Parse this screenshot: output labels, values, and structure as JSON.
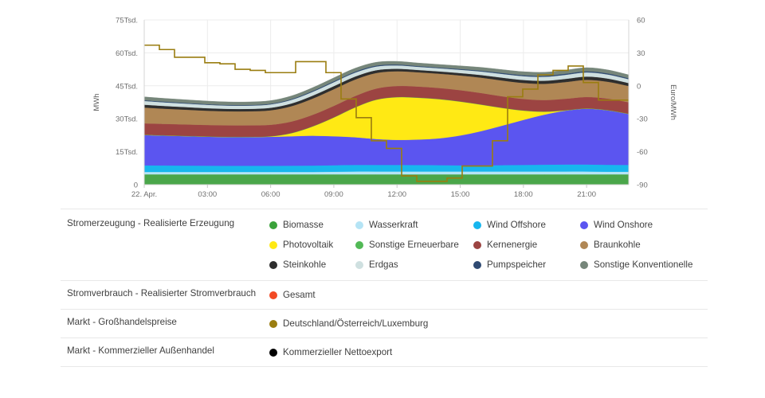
{
  "chart_data": {
    "type": "area",
    "title": "",
    "subtitle": "",
    "stacking": "normal",
    "grid": true,
    "legend_position": "bottom-table",
    "xlabel": "",
    "ylabel": "MWh",
    "y2label": "Euro/MWh",
    "x_tick_labels": [
      "22. Apr.",
      "03:00",
      "06:00",
      "09:00",
      "12:00",
      "15:00",
      "18:00",
      "21:00"
    ],
    "y_tick_labels": [
      "0",
      "15Tsd.",
      "30Tsd.",
      "45Tsd.",
      "60Tsd.",
      "75Tsd."
    ],
    "y_tick_values": [
      0,
      15000,
      30000,
      45000,
      60000,
      75000
    ],
    "ylim": [
      0,
      75000
    ],
    "y2_tick_labels": [
      "-90",
      "-60",
      "-30",
      "0",
      "30",
      "60"
    ],
    "y2_tick_values": [
      -90,
      -60,
      -30,
      0,
      30,
      60
    ],
    "y2lim": [
      -90,
      60
    ],
    "x": [
      "00:00",
      "01:00",
      "02:00",
      "03:00",
      "04:00",
      "05:00",
      "06:00",
      "07:00",
      "08:00",
      "09:00",
      "10:00",
      "11:00",
      "12:00",
      "13:00",
      "14:00",
      "15:00",
      "16:00",
      "17:00",
      "18:00",
      "19:00",
      "20:00",
      "21:00",
      "22:00",
      "23:00"
    ],
    "series": [
      {
        "name": "Biomasse",
        "color": "#4aa64a",
        "values": [
          4700,
          4700,
          4700,
          4700,
          4700,
          4700,
          4700,
          4700,
          4700,
          4700,
          4700,
          4700,
          4700,
          4700,
          4700,
          4700,
          4700,
          4700,
          4700,
          4700,
          4700,
          4700,
          4700,
          4700
        ]
      },
      {
        "name": "Wasserkraft",
        "color": "#b5e4f5",
        "values": [
          1100,
          1100,
          1100,
          1100,
          1100,
          1100,
          1100,
          1100,
          1100,
          1200,
          1300,
          1300,
          1300,
          1300,
          1300,
          1300,
          1300,
          1300,
          1300,
          1300,
          1300,
          1300,
          1200,
          1200
        ]
      },
      {
        "name": "Wind Offshore",
        "color": "#17b6ee",
        "values": [
          3000,
          2950,
          2900,
          2850,
          2800,
          2800,
          2800,
          2850,
          2900,
          2950,
          3000,
          3000,
          3000,
          2950,
          2900,
          2800,
          2800,
          2900,
          3000,
          3100,
          3200,
          3200,
          3150,
          3100
        ]
      },
      {
        "name": "Wind Onshore",
        "color": "#5b55f0",
        "values": [
          13800,
          13600,
          13400,
          13200,
          13100,
          13100,
          13200,
          13400,
          13600,
          13200,
          12600,
          11800,
          11400,
          11600,
          12200,
          13600,
          15600,
          18000,
          20500,
          22800,
          24500,
          25400,
          24800,
          23200
        ]
      },
      {
        "name": "Photovoltaik",
        "color": "#ffe914",
        "values": [
          0,
          0,
          0,
          0,
          0,
          0,
          150,
          1400,
          4200,
          8500,
          13500,
          17800,
          19400,
          19000,
          17800,
          15400,
          12000,
          8000,
          4200,
          1300,
          100,
          0,
          0,
          0
        ]
      },
      {
        "name": "Sonstige Erneuerbare",
        "color": "#52b956",
        "values": [
          120,
          120,
          120,
          120,
          120,
          120,
          120,
          120,
          120,
          120,
          120,
          120,
          120,
          120,
          120,
          120,
          120,
          120,
          120,
          120,
          120,
          120,
          120,
          120
        ]
      },
      {
        "name": "Kernenergie",
        "color": "#9c4442",
        "values": [
          5200,
          5200,
          5200,
          5200,
          5200,
          5200,
          5200,
          5200,
          5200,
          5200,
          5100,
          5000,
          5000,
          5000,
          5000,
          5100,
          5200,
          5200,
          5200,
          5200,
          5200,
          5200,
          5200,
          5200
        ]
      },
      {
        "name": "Braunkohle",
        "color": "#b08755",
        "values": [
          7200,
          6900,
          6700,
          6500,
          6400,
          6400,
          6600,
          7000,
          7400,
          7600,
          7500,
          7100,
          6700,
          6500,
          6500,
          6700,
          7000,
          7200,
          7300,
          7400,
          7600,
          7800,
          7700,
          7400
        ]
      },
      {
        "name": "Steinkohle",
        "color": "#2e2e2e",
        "values": [
          1300,
          1250,
          1200,
          1150,
          1100,
          1100,
          1150,
          1250,
          1350,
          1400,
          1380,
          1280,
          1150,
          1050,
          1050,
          1100,
          1200,
          1300,
          1350,
          1400,
          1450,
          1500,
          1450,
          1350
        ]
      },
      {
        "name": "Erdgas",
        "color": "#cfe0e0",
        "values": [
          1700,
          1650,
          1600,
          1550,
          1500,
          1500,
          1550,
          1650,
          1750,
          1800,
          1780,
          1680,
          1550,
          1450,
          1450,
          1500,
          1600,
          1700,
          1750,
          1800,
          1850,
          1900,
          1850,
          1750
        ]
      },
      {
        "name": "Pumpspeicher",
        "color": "#2f4a72",
        "values": [
          350,
          330,
          310,
          290,
          280,
          280,
          300,
          340,
          380,
          420,
          440,
          420,
          380,
          340,
          330,
          350,
          390,
          430,
          460,
          480,
          500,
          520,
          500,
          450
        ]
      },
      {
        "name": "Sonstige Konventionelle",
        "color": "#76867a",
        "values": [
          1500,
          1450,
          1420,
          1400,
          1380,
          1380,
          1400,
          1450,
          1500,
          1550,
          1550,
          1500,
          1430,
          1380,
          1380,
          1420,
          1480,
          1520,
          1550,
          1580,
          1600,
          1620,
          1580,
          1520
        ]
      }
    ],
    "lines": [
      {
        "name": "Deutschland/Österreich/Luxemburg",
        "color": "#9a7d10",
        "axis": "y2",
        "step": true,
        "values": [
          37,
          33,
          26,
          26,
          21,
          20,
          15,
          14,
          12,
          12,
          22,
          22,
          12,
          -12,
          -29,
          -50,
          -57,
          -82,
          -87,
          -87,
          -84,
          -73,
          -73,
          -50,
          -10,
          -3,
          10,
          14,
          18,
          3,
          -13,
          -13
        ]
      },
      {
        "name": "Gesamt",
        "color": "#f24a25",
        "axis": "y",
        "visible": false,
        "values": []
      },
      {
        "name": "Kommerzieller Nettoexport",
        "color": "#000000",
        "axis": "y",
        "visible": false,
        "values": []
      }
    ]
  },
  "axes": {
    "left_title": "MWh",
    "right_title": "Euro/MWh",
    "left_ticks": [
      "75Tsd.",
      "60Tsd.",
      "45Tsd.",
      "30Tsd.",
      "15Tsd.",
      "0"
    ],
    "right_ticks": [
      "60",
      "30",
      "0",
      "-30",
      "-60",
      "-90"
    ],
    "x_ticks": [
      "22. Apr.",
      "03:00",
      "06:00",
      "09:00",
      "12:00",
      "15:00",
      "18:00",
      "21:00"
    ]
  },
  "legend": {
    "rows": [
      {
        "category": "Stromerzeugung - Realisierte Erzeugung",
        "layout": "grid4",
        "items": [
          {
            "label": "Biomasse",
            "color": "#3aa23a"
          },
          {
            "label": "Wasserkraft",
            "color": "#b5e4f5"
          },
          {
            "label": "Wind Offshore",
            "color": "#17b6ee"
          },
          {
            "label": "Wind Onshore",
            "color": "#5b55f0"
          },
          {
            "label": "Photovoltaik",
            "color": "#ffe914"
          },
          {
            "label": "Sonstige Erneuerbare",
            "color": "#52b956"
          },
          {
            "label": "Kernenergie",
            "color": "#9c4442"
          },
          {
            "label": "Braunkohle",
            "color": "#b08755"
          },
          {
            "label": "Steinkohle",
            "color": "#2e2e2e"
          },
          {
            "label": "Erdgas",
            "color": "#cfe0e0"
          },
          {
            "label": "Pumpspeicher",
            "color": "#2f4a72"
          },
          {
            "label": "Sonstige Konventionelle",
            "color": "#76867a"
          }
        ]
      },
      {
        "category": "Stromverbrauch - Realisierter Stromverbrauch",
        "layout": "grid1",
        "items": [
          {
            "label": "Gesamt",
            "color": "#f24a25"
          }
        ]
      },
      {
        "category": "Markt - Großhandelspreise",
        "layout": "grid1",
        "items": [
          {
            "label": "Deutschland/Österreich/Luxemburg",
            "color": "#9a7d10"
          }
        ]
      },
      {
        "category": "Markt - Kommerzieller Außenhandel",
        "layout": "grid1",
        "items": [
          {
            "label": "Kommerzieller Nettoexport",
            "color": "#000000"
          }
        ]
      }
    ]
  }
}
